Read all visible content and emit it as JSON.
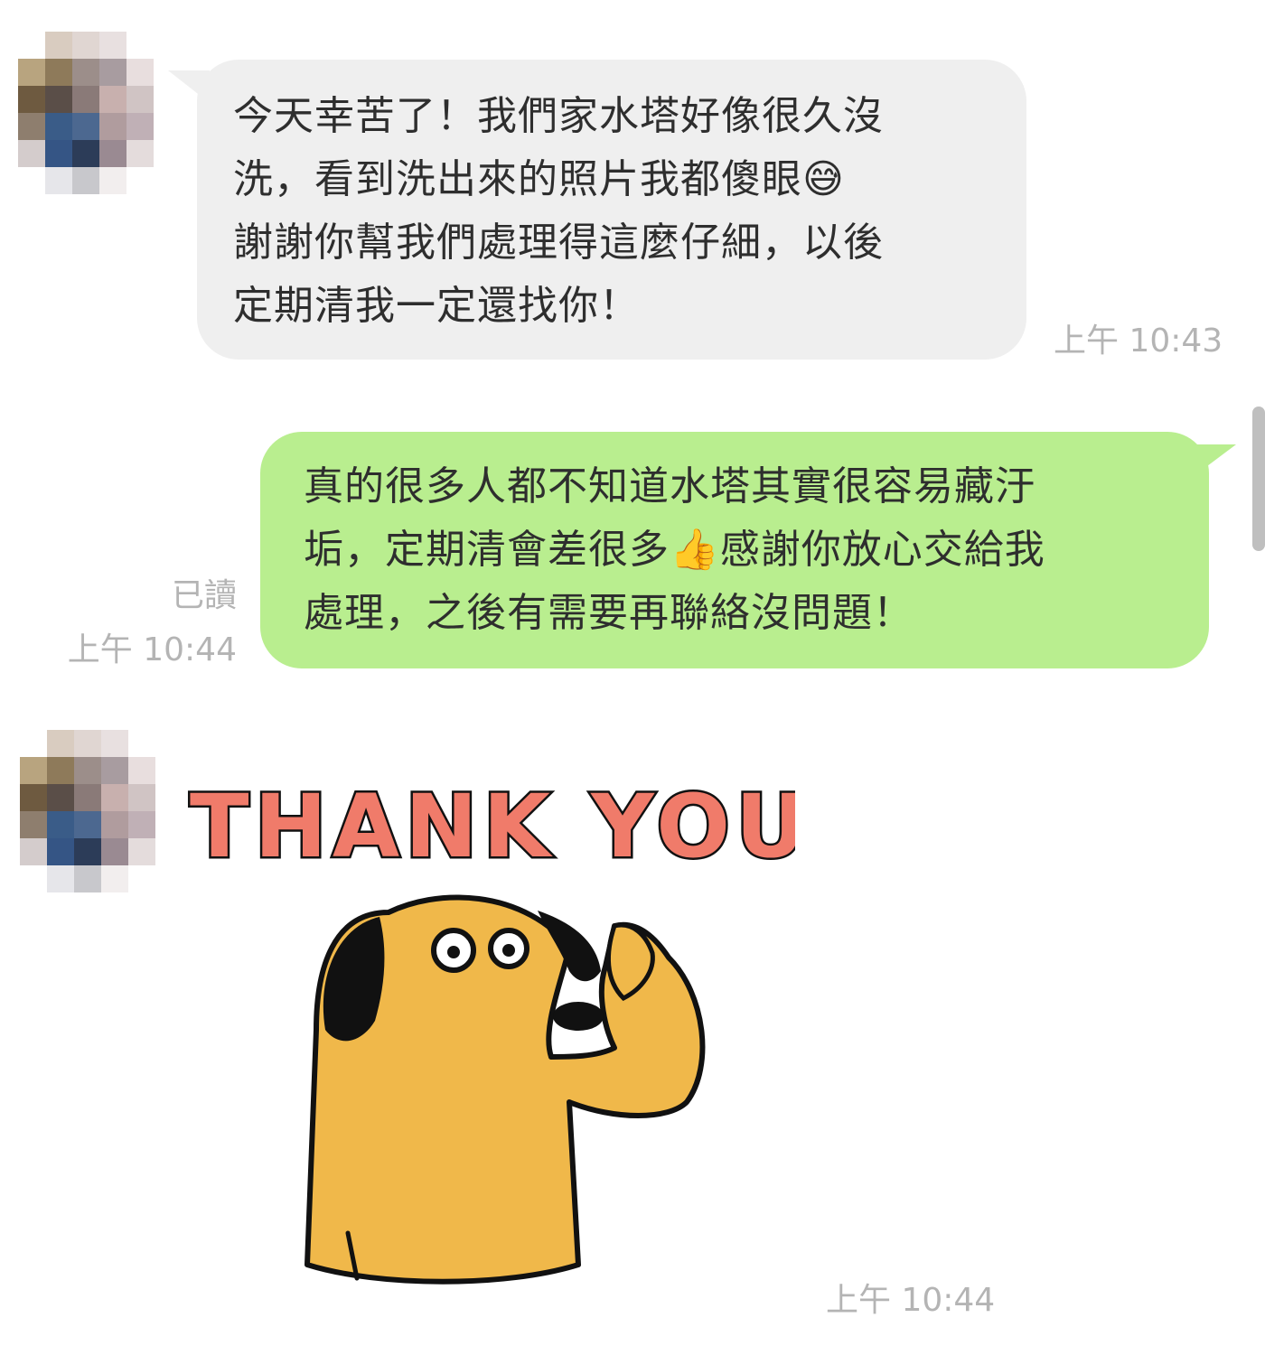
{
  "messages": [
    {
      "side": "incoming",
      "lines": [
        "今天幸苦了！我們家水塔好像很久沒",
        "洗，看到洗出來的照片我都傻眼😅",
        "謝謝你幫我們處理得這麼仔細，以後",
        "定期清我一定還找你！"
      ],
      "time": "上午 10:43"
    },
    {
      "side": "outgoing",
      "lines": [
        "真的很多人都不知道水塔其實很容易藏汙",
        "垢，定期清會差很多👍感謝你放心交給我",
        "處理，之後有需要再聯絡沒問題！"
      ],
      "read_status": "已讀",
      "time": "上午 10:44"
    },
    {
      "side": "incoming",
      "sticker_text": "THANK YOU",
      "sticker_icon": "dog-saluting-sticker",
      "time": "上午 10:44"
    }
  ],
  "colors": {
    "incoming_bubble": "#efefef",
    "outgoing_bubble": "#b9ee8f",
    "meta_text": "#b4b4b4",
    "sticker_text_fill": "#f07b6a",
    "dog_fill": "#f0b84a"
  }
}
